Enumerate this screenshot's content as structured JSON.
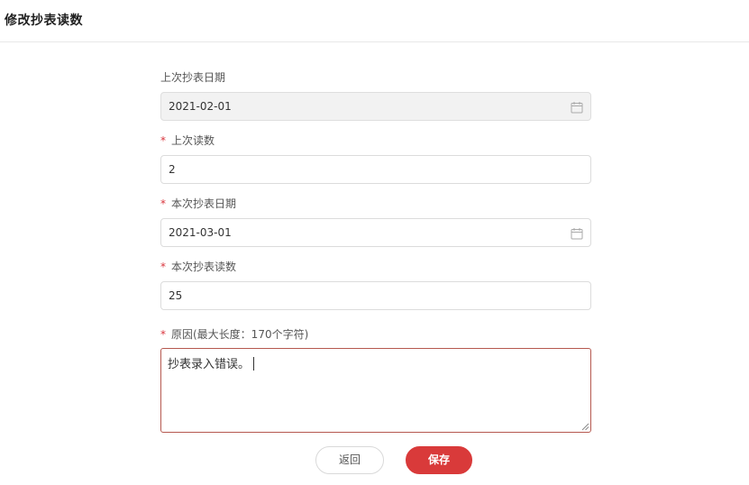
{
  "header": {
    "title": "修改抄表读数"
  },
  "form": {
    "last_date": {
      "label": "上次抄表日期",
      "value": "2021-02-01",
      "icon": "calendar-icon",
      "disabled": true
    },
    "last_reading": {
      "required_mark": "*",
      "label": "上次读数",
      "value": "2"
    },
    "current_date": {
      "required_mark": "*",
      "label": "本次抄表日期",
      "value": "2021-03-01",
      "icon": "calendar-icon"
    },
    "current_reading": {
      "required_mark": "*",
      "label": "本次抄表读数",
      "value": "25"
    },
    "reason": {
      "required_mark": "*",
      "label": "原因(最大长度：170个字符)",
      "value": "抄表录入错误。"
    }
  },
  "buttons": {
    "back_label": "返回",
    "save_label": "保存"
  },
  "colors": {
    "accent": "#d93a3a",
    "required": "#d9363e",
    "focus_border": "#b5584f"
  }
}
